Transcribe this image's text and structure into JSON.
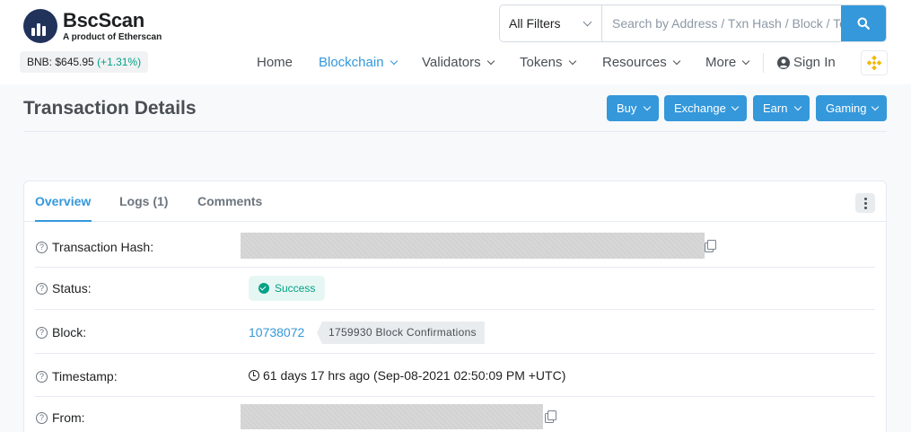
{
  "brand": {
    "name": "BscScan",
    "tagline": "A product of Etherscan",
    "price_label": "BNB: $645.95",
    "price_change": "(+1.31%)"
  },
  "search": {
    "filter": "All Filters",
    "placeholder": "Search by Address / Txn Hash / Block / Token"
  },
  "nav": {
    "home": "Home",
    "blockchain": "Blockchain",
    "validators": "Validators",
    "tokens": "Tokens",
    "resources": "Resources",
    "more": "More",
    "signin": "Sign In"
  },
  "page": {
    "title": "Transaction Details",
    "actions": [
      "Buy",
      "Exchange",
      "Earn",
      "Gaming"
    ]
  },
  "tabs": {
    "overview": "Overview",
    "logs": "Logs (1)",
    "comments": "Comments"
  },
  "details": {
    "hash_label": "Transaction Hash:",
    "status_label": "Status:",
    "status_value": "Success",
    "block_label": "Block:",
    "block_value": "10738072",
    "confirmations": "1759930 Block Confirmations",
    "timestamp_label": "Timestamp:",
    "timestamp_value": "61 days 17 hrs ago (Sep-08-2021 02:50:09 PM +UTC)",
    "from_label": "From:"
  },
  "colors": {
    "accent": "#3498db",
    "success": "#00a186",
    "brand_dark": "#21325b",
    "bnb_yellow": "#f0b90b"
  }
}
